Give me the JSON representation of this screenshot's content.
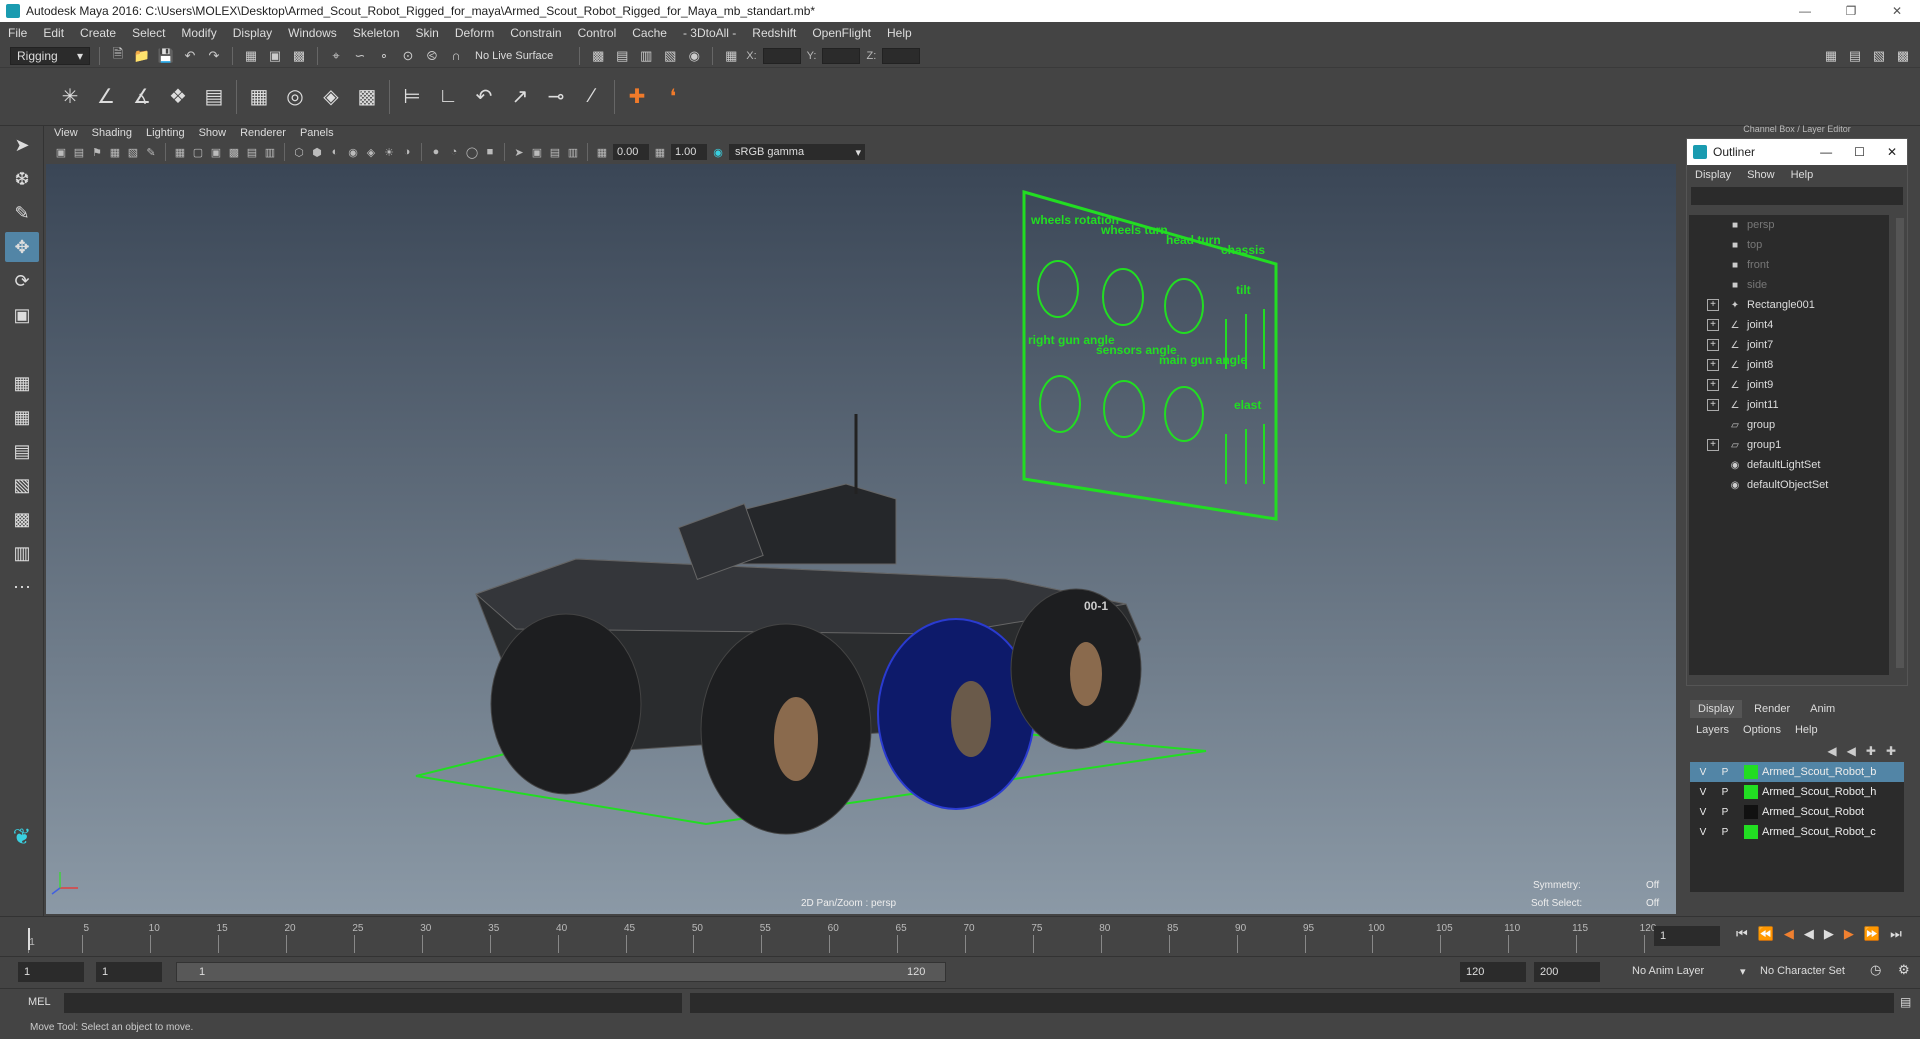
{
  "window": {
    "title": "Autodesk Maya 2016: C:\\Users\\MOLEX\\Desktop\\Armed_Scout_Robot_Rigged_for_maya\\Armed_Scout_Robot_Rigged_for_Maya_mb_standart.mb*"
  },
  "menubar": [
    "File",
    "Edit",
    "Create",
    "Select",
    "Modify",
    "Display",
    "Windows",
    "Skeleton",
    "Skin",
    "Deform",
    "Constrain",
    "Control",
    "Cache",
    "- 3DtoAll -",
    "Redshift",
    "OpenFlight",
    "Help"
  ],
  "statusline": {
    "mode": "Rigging",
    "live_surface": "No Live Surface",
    "x_label": "X:",
    "y_label": "Y:",
    "z_label": "Z:"
  },
  "panel_menu": [
    "View",
    "Shading",
    "Lighting",
    "Show",
    "Renderer",
    "Panels"
  ],
  "panel_bar": {
    "near": "0.00",
    "far": "1.00",
    "color_space": "sRGB gamma"
  },
  "viewport": {
    "camera_label": "2D Pan/Zoom : persp",
    "symmetry_label": "Symmetry:",
    "symmetry_value": "Off",
    "softselect_label": "Soft Select:",
    "softselect_value": "Off",
    "panel_text": [
      "wheels rotation",
      "wheels turn",
      "head turn",
      "chassis",
      "tilt",
      "right gun angle",
      "sensors angle",
      "main gun angle",
      "elast"
    ],
    "vehicle_id": "00-1"
  },
  "channel_box_header": "Channel Box / Layer Editor",
  "outliner": {
    "title": "Outliner",
    "menu": [
      "Display",
      "Show",
      "Help"
    ],
    "items": [
      {
        "label": "persp",
        "icon": "camera-icon",
        "expand": false,
        "dim": true
      },
      {
        "label": "top",
        "icon": "camera-icon",
        "expand": false,
        "dim": true
      },
      {
        "label": "front",
        "icon": "camera-icon",
        "expand": false,
        "dim": true
      },
      {
        "label": "side",
        "icon": "camera-icon",
        "expand": false,
        "dim": true
      },
      {
        "label": "Rectangle001",
        "icon": "curve-icon",
        "expand": true,
        "dim": false
      },
      {
        "label": "joint4",
        "icon": "joint-icon",
        "expand": true,
        "dim": false
      },
      {
        "label": "joint7",
        "icon": "joint-icon",
        "expand": true,
        "dim": false
      },
      {
        "label": "joint8",
        "icon": "joint-icon",
        "expand": true,
        "dim": false
      },
      {
        "label": "joint9",
        "icon": "joint-icon",
        "expand": true,
        "dim": false
      },
      {
        "label": "joint11",
        "icon": "joint-icon",
        "expand": true,
        "dim": false
      },
      {
        "label": "group",
        "icon": "group-icon",
        "expand": false,
        "dim": false
      },
      {
        "label": "group1",
        "icon": "group-icon",
        "expand": true,
        "dim": false
      },
      {
        "label": "defaultLightSet",
        "icon": "set-icon",
        "expand": false,
        "dim": false
      },
      {
        "label": "defaultObjectSet",
        "icon": "set-icon",
        "expand": false,
        "dim": false
      }
    ]
  },
  "layer_editor": {
    "tabs": [
      "Display",
      "Render",
      "Anim"
    ],
    "menu": [
      "Layers",
      "Options",
      "Help"
    ],
    "rows": [
      {
        "v": "V",
        "p": "P",
        "name": "Armed_Scout_Robot_b",
        "color": "#22dd22",
        "selected": true
      },
      {
        "v": "V",
        "p": "P",
        "name": "Armed_Scout_Robot_h",
        "color": "#22dd22",
        "selected": false
      },
      {
        "v": "V",
        "p": "P",
        "name": "Armed_Scout_Robot",
        "color": "#111111",
        "selected": false
      },
      {
        "v": "V",
        "p": "P",
        "name": "Armed_Scout_Robot_c",
        "color": "#22dd22",
        "selected": false
      }
    ]
  },
  "timeline": {
    "ticks": [
      "1",
      "5",
      "10",
      "15",
      "20",
      "25",
      "30",
      "35",
      "40",
      "45",
      "50",
      "55",
      "60",
      "65",
      "70",
      "75",
      "80",
      "85",
      "90",
      "95",
      "100",
      "105",
      "110",
      "115",
      "120"
    ],
    "current_frame": "1"
  },
  "range": {
    "start": "1",
    "start2": "1",
    "slider_start": "1",
    "slider_end": "120",
    "end": "120",
    "end2": "200",
    "anim_layer": "No Anim Layer",
    "char_set": "No Character Set"
  },
  "command": {
    "label": "MEL"
  },
  "help_line": "Move Tool: Select an object to move."
}
